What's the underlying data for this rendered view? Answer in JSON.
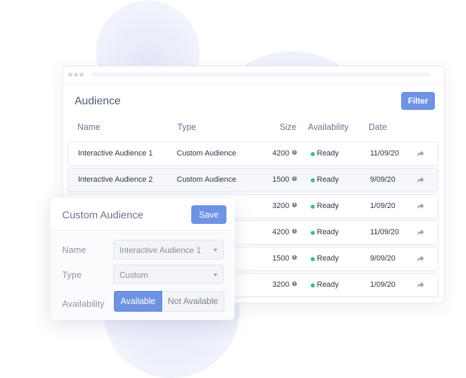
{
  "audience": {
    "title": "Audience",
    "filter_label": "Filter",
    "columns": {
      "name": "Name",
      "type": "Type",
      "size": "Size",
      "availability": "Availability",
      "date": "Date"
    },
    "rows": [
      {
        "name": "Interactive Audience 1",
        "type": "Custom Audience",
        "size": "4200",
        "availability": "Ready",
        "date": "11/09/20"
      },
      {
        "name": "Interactive Audience 2",
        "type": "Custom Audience",
        "size": "1500",
        "availability": "Ready",
        "date": "9/09/20"
      },
      {
        "name": "",
        "type": "",
        "size": "3200",
        "availability": "Ready",
        "date": "1/09/20"
      },
      {
        "name": "",
        "type": "",
        "size": "4200",
        "availability": "Ready",
        "date": "11/09/20"
      },
      {
        "name": "",
        "type": "",
        "size": "1500",
        "availability": "Ready",
        "date": "9/09/20"
      },
      {
        "name": "",
        "type": "",
        "size": "3200",
        "availability": "Ready",
        "date": "1/09/20"
      }
    ]
  },
  "card": {
    "title": "Custom Audience",
    "save_label": "Save",
    "name_label": "Name",
    "name_value": "Interactive Audience 1",
    "type_label": "Type",
    "type_value": "Custom",
    "availability_label": "Availability",
    "available_label": "Available",
    "not_available_label": "Not Available"
  },
  "colors": {
    "accent": "#6f93e3",
    "ready": "#3bbf8c"
  },
  "icons": [
    "info-icon",
    "share-icon",
    "chevron-down-icon"
  ]
}
